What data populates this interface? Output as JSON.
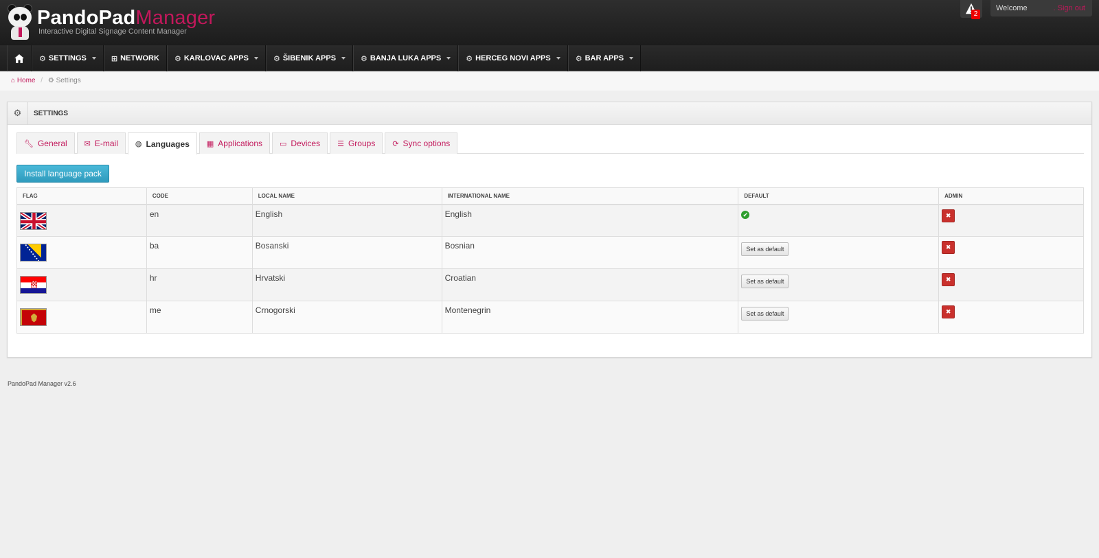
{
  "app": {
    "title_main": "PandoPad",
    "title_accent": "Manager",
    "subtitle": "Interactive Digital Signage Content Manager"
  },
  "topbar": {
    "alert_count": "2",
    "welcome": "Welcome",
    "signout": ". Sign out"
  },
  "nav": {
    "items": [
      {
        "label": "SETTINGS",
        "icon": "gear-icon"
      },
      {
        "label": "NETWORK",
        "icon": "sitemap-icon"
      },
      {
        "label": "KARLOVAC APPS",
        "icon": "gears-icon"
      },
      {
        "label": "ŠIBENIK APPS",
        "icon": "gears-icon"
      },
      {
        "label": "BANJA LUKA APPS",
        "icon": "gears-icon"
      },
      {
        "label": "HERCEG NOVI APPS",
        "icon": "gears-icon"
      },
      {
        "label": "BAR APPS",
        "icon": "gears-icon"
      }
    ]
  },
  "breadcrumb": {
    "home": "Home",
    "current": "Settings"
  },
  "panel": {
    "title": "SETTINGS",
    "tabs": [
      {
        "label": "General",
        "icon": "wrench-icon"
      },
      {
        "label": "E-mail",
        "icon": "envelope-icon"
      },
      {
        "label": "Languages",
        "icon": "globe-icon",
        "active": true
      },
      {
        "label": "Applications",
        "icon": "th-large-icon"
      },
      {
        "label": "Devices",
        "icon": "desktop-icon"
      },
      {
        "label": "Groups",
        "icon": "list-icon"
      },
      {
        "label": "Sync options",
        "icon": "refresh-icon"
      }
    ],
    "install_button": "Install language pack"
  },
  "table": {
    "headers": [
      "FLAG",
      "CODE",
      "LOCAL NAME",
      "INTERNATIONAL NAME",
      "DEFAULT",
      "ADMIN"
    ],
    "rows": [
      {
        "flag": "uk-flag",
        "code": "en",
        "local": "English",
        "international": "English",
        "is_default": true
      },
      {
        "flag": "bosnia-flag",
        "code": "ba",
        "local": "Bosanski",
        "international": "Bosnian",
        "is_default": false
      },
      {
        "flag": "croatia-flag",
        "code": "hr",
        "local": "Hrvatski",
        "international": "Croatian",
        "is_default": false
      },
      {
        "flag": "montenegro-flag",
        "code": "me",
        "local": "Crnogorski",
        "international": "Montenegrin",
        "is_default": false
      }
    ],
    "set_default_label": "Set as default",
    "delete_label": "✖"
  },
  "footer": {
    "version": "PandoPad Manager v2.6"
  },
  "colors": {
    "accent": "#c2185b",
    "install_button": "#3aa8cb",
    "delete_button": "#c9302c",
    "default_check": "#2e9e2e"
  }
}
